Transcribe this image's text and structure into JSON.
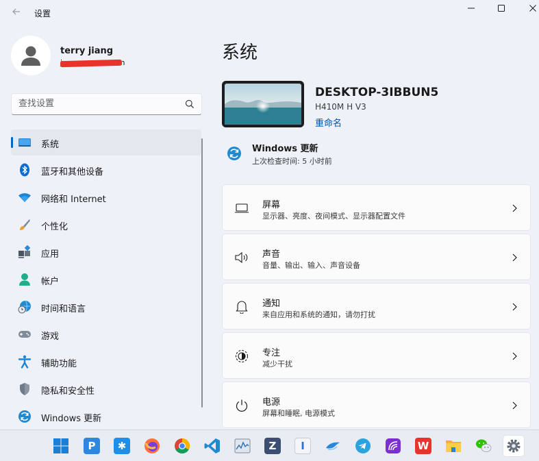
{
  "window": {
    "title": "设置",
    "back_icon": "arrow-left-icon",
    "controls": [
      "minimize-icon",
      "maximize-icon",
      "close-icon"
    ]
  },
  "account": {
    "name": "terry jiang",
    "avatar_icon": "person-icon",
    "email_visible_fragments": [
      "j",
      "o",
      "om"
    ]
  },
  "search": {
    "placeholder": "查找设置",
    "icon": "search-icon"
  },
  "nav": {
    "items": [
      {
        "label": "系统",
        "icon": "system-display-icon",
        "active": true
      },
      {
        "label": "蓝牙和其他设备",
        "icon": "bluetooth-icon",
        "active": false
      },
      {
        "label": "网络和 Internet",
        "icon": "wifi-icon",
        "active": false
      },
      {
        "label": "个性化",
        "icon": "paintbrush-icon",
        "active": false
      },
      {
        "label": "应用",
        "icon": "apps-icon",
        "active": false
      },
      {
        "label": "帐户",
        "icon": "account-icon",
        "active": false
      },
      {
        "label": "时间和语言",
        "icon": "globe-clock-icon",
        "active": false
      },
      {
        "label": "游戏",
        "icon": "gamepad-icon",
        "active": false
      },
      {
        "label": "辅助功能",
        "icon": "accessibility-icon",
        "active": false
      },
      {
        "label": "隐私和安全性",
        "icon": "shield-icon",
        "active": false
      },
      {
        "label": "Windows 更新",
        "icon": "windows-update-icon",
        "active": false
      }
    ]
  },
  "main": {
    "title": "系统",
    "device": {
      "name": "DESKTOP-3IBBUN5",
      "model": "H410M H V3",
      "rename_label": "重命名"
    },
    "windows_update": {
      "title": "Windows 更新",
      "subtitle": "上次检查时间: 5 小时前"
    },
    "cards": [
      {
        "title": "屏幕",
        "desc": "显示器、亮度、夜间模式、显示器配置文件",
        "icon": "monitor-icon"
      },
      {
        "title": "声音",
        "desc": "音量、输出、输入、声音设备",
        "icon": "speaker-icon"
      },
      {
        "title": "通知",
        "desc": "来自应用和系统的通知，请勿打扰",
        "icon": "bell-icon"
      },
      {
        "title": "专注",
        "desc": "减少干扰",
        "icon": "focus-icon"
      },
      {
        "title": "电源",
        "desc": "屏幕和睡眠, 电源模式",
        "icon": "power-icon"
      }
    ]
  },
  "taskbar": {
    "apps": [
      {
        "name": "start-icon",
        "glyph": "",
        "color": "#1a7fd6"
      },
      {
        "name": "p-app-icon",
        "glyph": "P",
        "color": "#2d86e0"
      },
      {
        "name": "star-app-icon",
        "glyph": "✱",
        "color": "#1e8fe8"
      },
      {
        "name": "firefox-icon",
        "glyph": "",
        "color": "#ff7139"
      },
      {
        "name": "chrome-icon",
        "glyph": "",
        "color": "#db4437"
      },
      {
        "name": "vscode-icon",
        "glyph": "",
        "color": "#1f8ad2"
      },
      {
        "name": "chart-app-icon",
        "glyph": "",
        "color": "#dfe6ef"
      },
      {
        "name": "z-app-icon",
        "glyph": "Z",
        "color": "#3c4f73"
      },
      {
        "name": "note-app-icon",
        "glyph": "I",
        "color": "#f3f5f8"
      },
      {
        "name": "flying-app-icon",
        "glyph": "",
        "color": "#2a86d6"
      },
      {
        "name": "telegram-icon",
        "glyph": "",
        "color": "#2aa3df"
      },
      {
        "name": "purple-app-icon",
        "glyph": "",
        "color": "#7b2fd0"
      },
      {
        "name": "wps-icon",
        "glyph": "W",
        "color": "#e8322c"
      },
      {
        "name": "folder-icon",
        "glyph": "",
        "color": "#f3b32a"
      },
      {
        "name": "wechat-icon",
        "glyph": "",
        "color": "#2dc100"
      },
      {
        "name": "settings-icon",
        "glyph": "",
        "color": "#6b7480",
        "active": true
      }
    ]
  },
  "colors": {
    "accent": "#0067c0",
    "window_bg": "#eef2f8",
    "card_bg": "#fbfbfc",
    "redaction": "#e8322c"
  }
}
